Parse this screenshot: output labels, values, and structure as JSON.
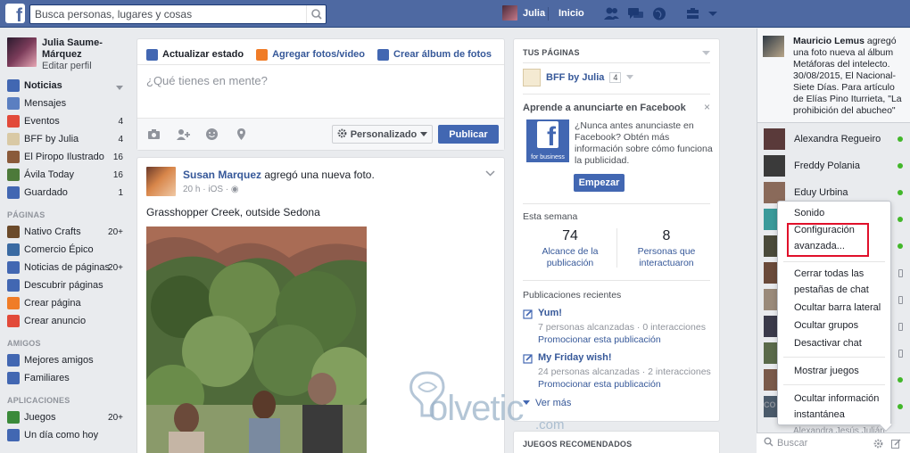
{
  "topbar": {
    "search_placeholder": "Busca personas, lugares y cosas",
    "user_name": "Julia",
    "home_label": "Inicio",
    "icons": [
      "friends-icon",
      "messages-icon",
      "globe-icon",
      "privacy-icon",
      "dropdown-icon"
    ],
    "brand_color": "#4e69a2"
  },
  "leftnav": {
    "profile_name": "Julia Saume-Márquez",
    "edit_profile": "Editar perfil",
    "favorites": [
      {
        "label": "Noticias",
        "count": "",
        "icon": "news-feed-icon",
        "color": "#4267b2",
        "active": true
      },
      {
        "label": "Mensajes",
        "count": "",
        "icon": "messages-icon",
        "color": "#5b7fc1"
      },
      {
        "label": "Eventos",
        "count": "4",
        "icon": "events-icon",
        "color": "#e24a3a"
      },
      {
        "label": "BFF by Julia",
        "count": "4",
        "icon": "page-icon",
        "color": "#d9c9a5"
      },
      {
        "label": "El Piropo Ilustrado",
        "count": "16",
        "icon": "group-icon",
        "color": "#8a5a3a"
      },
      {
        "label": "Ávila Today",
        "count": "16",
        "icon": "group-icon",
        "color": "#4d7a3a"
      },
      {
        "label": "Guardado",
        "count": "1",
        "icon": "bookmark-icon",
        "color": "#4267b2"
      }
    ],
    "pages_head": "PÁGINAS",
    "pages": [
      {
        "label": "Nativo Crafts",
        "count": "20+",
        "icon": "page-icon",
        "color": "#6b4a2a"
      },
      {
        "label": "Comercio Épico",
        "count": "",
        "icon": "page-icon",
        "color": "#3a6aa2"
      },
      {
        "label": "Noticias de páginas",
        "count": "20+",
        "icon": "pages-feed-icon",
        "color": "#4267b2"
      },
      {
        "label": "Descubrir páginas",
        "count": "",
        "icon": "like-icon",
        "color": "#4267b2"
      },
      {
        "label": "Crear página",
        "count": "",
        "icon": "flag-icon",
        "color": "#f07c27"
      },
      {
        "label": "Crear anuncio",
        "count": "",
        "icon": "megaphone-icon",
        "color": "#e24a3a"
      }
    ],
    "friends_head": "AMIGOS",
    "friends": [
      {
        "label": "Mejores amigos",
        "count": "",
        "icon": "star-icon",
        "color": "#4267b2"
      },
      {
        "label": "Familiares",
        "count": "",
        "icon": "house-icon",
        "color": "#4267b2"
      }
    ],
    "apps_head": "APLICACIONES",
    "apps": [
      {
        "label": "Juegos",
        "count": "20+",
        "icon": "games-icon",
        "color": "#3a8a3a"
      },
      {
        "label": "Un día como hoy",
        "count": "",
        "icon": "clock-icon",
        "color": "#4267b2"
      }
    ]
  },
  "composer": {
    "tab_status": "Actualizar estado",
    "tab_photo": "Agregar fotos/video",
    "tab_album": "Crear álbum de fotos",
    "placeholder": "¿Qué tienes en mente?",
    "privacy_label": "Personalizado",
    "publish_label": "Publicar"
  },
  "post": {
    "author": "Susan Marquez",
    "action": " agregó una nueva foto.",
    "time": "20 h",
    "source": "iOS",
    "text": "Grasshopper Creek, outside Sedona"
  },
  "pages_box": {
    "head": "TUS PÁGINAS",
    "page_name": "BFF by Julia",
    "page_count": "4",
    "ads_head": "Aprende a anunciarte en Facebook",
    "ads_text": "¿Nunca antes anunciaste en Facebook? Obtén más información sobre cómo funciona la publicidad.",
    "fb_business": "for business",
    "start_label": "Empezar",
    "week_head": "Esta semana",
    "reach_value": "74",
    "reach_label": "Alcance de la publicación",
    "people_value": "8",
    "people_label": "Personas que interactuaron",
    "recent_head": "Publicaciones recientes",
    "recent": [
      {
        "title": "Yum!",
        "stats": "7 personas alcanzadas · 0 interacciones",
        "promote": "Promocionar esta publicación"
      },
      {
        "title": "My Friday wish!",
        "stats": "24 personas alcanzadas · 2 interacciones",
        "promote": "Promocionar esta publicación"
      }
    ],
    "more_label": "Ver más",
    "games_head": "JUEGOS RECOMENDADOS"
  },
  "chat": {
    "ticker_author": "Mauricio Lemus",
    "ticker_text": " agregó una foto nueva al álbum Metáforas del intelecto. 30/08/2015, El Nacional-Siete Días. Para artículo de Elías Pino Iturrieta, \"La prohibición del abucheo\"",
    "contacts": [
      {
        "name": "Alexandra Regueiro",
        "status": "online",
        "color": "#5a3a3a"
      },
      {
        "name": "Freddy Polania",
        "status": "online",
        "color": "#3a3a3a"
      },
      {
        "name": "Eduy Urbina",
        "status": "online",
        "color": "#8a6a5a"
      },
      {
        "name": "",
        "status": "online",
        "color": "#3a9a9a"
      },
      {
        "name": "",
        "status": "online",
        "color": "#4a4a3a"
      },
      {
        "name": "",
        "status": "mobile",
        "color": "#6a4a3a"
      },
      {
        "name": "",
        "status": "mobile",
        "color": "#9a8a7a"
      },
      {
        "name": "",
        "status": "mobile",
        "color": "#3a3a4a"
      },
      {
        "name": "",
        "status": "mobile",
        "color": "#5a6a4a"
      },
      {
        "name": "",
        "status": "online",
        "color": "#7a5a4a"
      },
      {
        "name": "",
        "status": "online",
        "color": "#4a5a6a"
      }
    ],
    "partial_head": "CO",
    "partial_row": "Alexandra Jesús Julián",
    "search_placeholder": "Buscar"
  },
  "menu": {
    "items": [
      "Sonido",
      "Configuración avanzada...",
      "Cerrar todas las pestañas de chat",
      "Ocultar barra lateral",
      "Ocultar grupos",
      "Desactivar chat",
      "Mostrar juegos",
      "Ocultar información instantánea"
    ],
    "highlight_color": "#e0102a"
  },
  "watermark": {
    "text": "olvetic",
    "suffix": ".com"
  }
}
